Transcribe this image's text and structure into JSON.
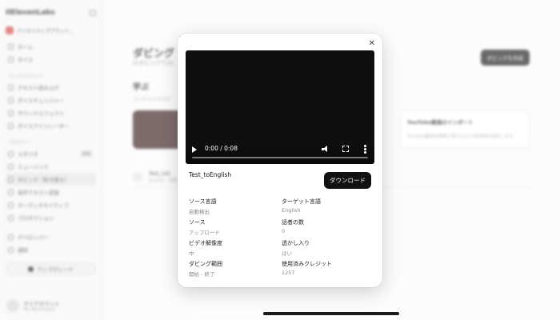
{
  "sidebar": {
    "brand": "IIElevenLabs",
    "workspace": "クリエイティブプラット...",
    "items_top": [
      {
        "label": "ホーム"
      },
      {
        "label": "ボイス"
      }
    ],
    "section_playground": "プレイグラウンド",
    "items_playground": [
      {
        "label": "テキスト読み上げ"
      },
      {
        "label": "ボイスチェンジャー"
      },
      {
        "label": "サウンドエフェクト"
      },
      {
        "label": "ボイスアイソレーター"
      }
    ],
    "section_products": "プロダクト",
    "items_products": [
      {
        "label": "スタジオ",
        "badge": "新規"
      },
      {
        "label": "ミュージック"
      },
      {
        "label": "ダビング（吹き替え）"
      },
      {
        "label": "音声テキスト変換"
      },
      {
        "label": "オーディオネイティブ"
      },
      {
        "label": "プロダクション"
      }
    ],
    "items_bottom": [
      {
        "label": "デベロッパー"
      },
      {
        "label": "通知"
      }
    ],
    "upgrade_label": "アップグレード",
    "account_name": "マイアカウント",
    "account_sub": "My Workspace"
  },
  "main": {
    "title": "ダビング（",
    "subtitle": "AIダビングで20",
    "create_button": "ダビングを作成",
    "learn_title": "学ぶ",
    "learn_sub": "コンテンツのダビ",
    "yt_card_title": "YouTube動画のインポート",
    "yt_card_desc": "YouTube動画を簡単に取り込んで多言語を追加します。",
    "row_title": "Test_toE",
    "row_sub": "English · 自動"
  },
  "modal": {
    "video": {
      "time": "0:00 / 0:08",
      "progress": 0.0
    },
    "file_name": "Test_toEnglish",
    "download_label": "ダウンロード",
    "fields": [
      {
        "label": "ソース言語",
        "value": "自動検出"
      },
      {
        "label": "ターゲット言語",
        "value": "English"
      },
      {
        "label": "ソース",
        "value": "アップロード"
      },
      {
        "label": "話者の数",
        "value": "0"
      },
      {
        "label": "ビデオ解像度",
        "value": "中"
      },
      {
        "label": "透かし入り",
        "value": "はい"
      },
      {
        "label": "ダビング範囲",
        "value": "開始 - 終了"
      },
      {
        "label": "使用済みクレジット",
        "value": "1257"
      }
    ]
  }
}
